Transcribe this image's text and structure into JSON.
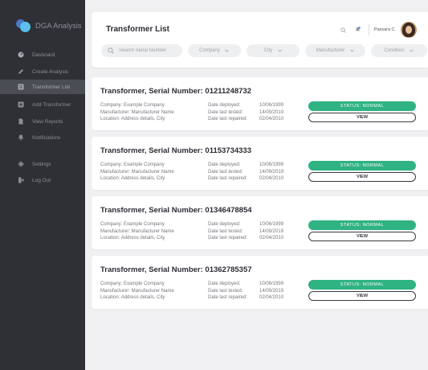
{
  "app": {
    "name": "DGA Analysis"
  },
  "sidebar": {
    "items": [
      {
        "label": "Dasboard",
        "icon": "gauge-icon"
      },
      {
        "label": "Create Analysis",
        "icon": "pencil-icon"
      },
      {
        "label": "Transformer List",
        "icon": "list-icon",
        "active": true
      },
      {
        "label": "Add Transformer",
        "icon": "plus-icon"
      },
      {
        "label": "View Reports",
        "icon": "document-icon"
      },
      {
        "label": "Notifications",
        "icon": "bell-icon"
      },
      {
        "label": "Settings",
        "icon": "gear-icon"
      },
      {
        "label": "Log Out",
        "icon": "logout-icon"
      }
    ]
  },
  "header": {
    "title": "Transformer List",
    "user_name": "Passara C.",
    "search_placeholder": "Search Serial Number",
    "filters": [
      "Company",
      "City",
      "Manufacturer",
      "Condition"
    ]
  },
  "transformers": [
    {
      "title": "Transformer, Serial Number: 01211248732",
      "company": "Company: Example Company",
      "manufacturer": "Manufacturer: Manufacturer Name",
      "location": "Location: Address details, City",
      "deployed_label": "Date deployed:",
      "deployed": "10/06/1999",
      "tested_label": "Date last tested:",
      "tested": "14/09/2019",
      "repaired_label": "Date last repaired:",
      "repaired": "02/04/2010",
      "status": "STATUS: NORMAL",
      "view_label": "VIEW"
    },
    {
      "title": "Transformer, Serial Number: 01153734333",
      "company": "Company: Example Company",
      "manufacturer": "Manufacturer: Manufacturer Name",
      "location": "Location: Address details, City",
      "deployed_label": "Date deployed:",
      "deployed": "10/06/1999",
      "tested_label": "Date last tested:",
      "tested": "14/09/2019",
      "repaired_label": "Date last repaired:",
      "repaired": "02/04/2010",
      "status": "STATUS: NORMAL",
      "view_label": "VIEW"
    },
    {
      "title": "Transformer, Serial Number: 01346478854",
      "company": "Company: Example Company",
      "manufacturer": "Manufacturer: Manufacturer Name",
      "location": "Location: Address details, City",
      "deployed_label": "Date deployed:",
      "deployed": "10/06/1999",
      "tested_label": "Date last tested:",
      "tested": "14/09/2019",
      "repaired_label": "Date last repaired:",
      "repaired": "02/04/2010",
      "status": "STATUS: NORMAL",
      "view_label": "VIEW"
    },
    {
      "title": "Transformer, Serial Number: 01362785357",
      "company": "Company: Example Company",
      "manufacturer": "Manufacturer: Manufacturer Name",
      "location": "Location: Address details, City",
      "deployed_label": "Date deployed:",
      "deployed": "10/06/1999",
      "tested_label": "Date last tested:",
      "tested": "14/09/2019",
      "repaired_label": "Date last repaired:",
      "repaired": "02/04/2010",
      "status": "STATUS: NORMAL",
      "view_label": "VIEW"
    }
  ],
  "colors": {
    "sidebar_bg": "#2e3035",
    "sidebar_active": "#4a4d53",
    "status_normal": "#2fb382",
    "page_bg": "#f0f0f2"
  }
}
